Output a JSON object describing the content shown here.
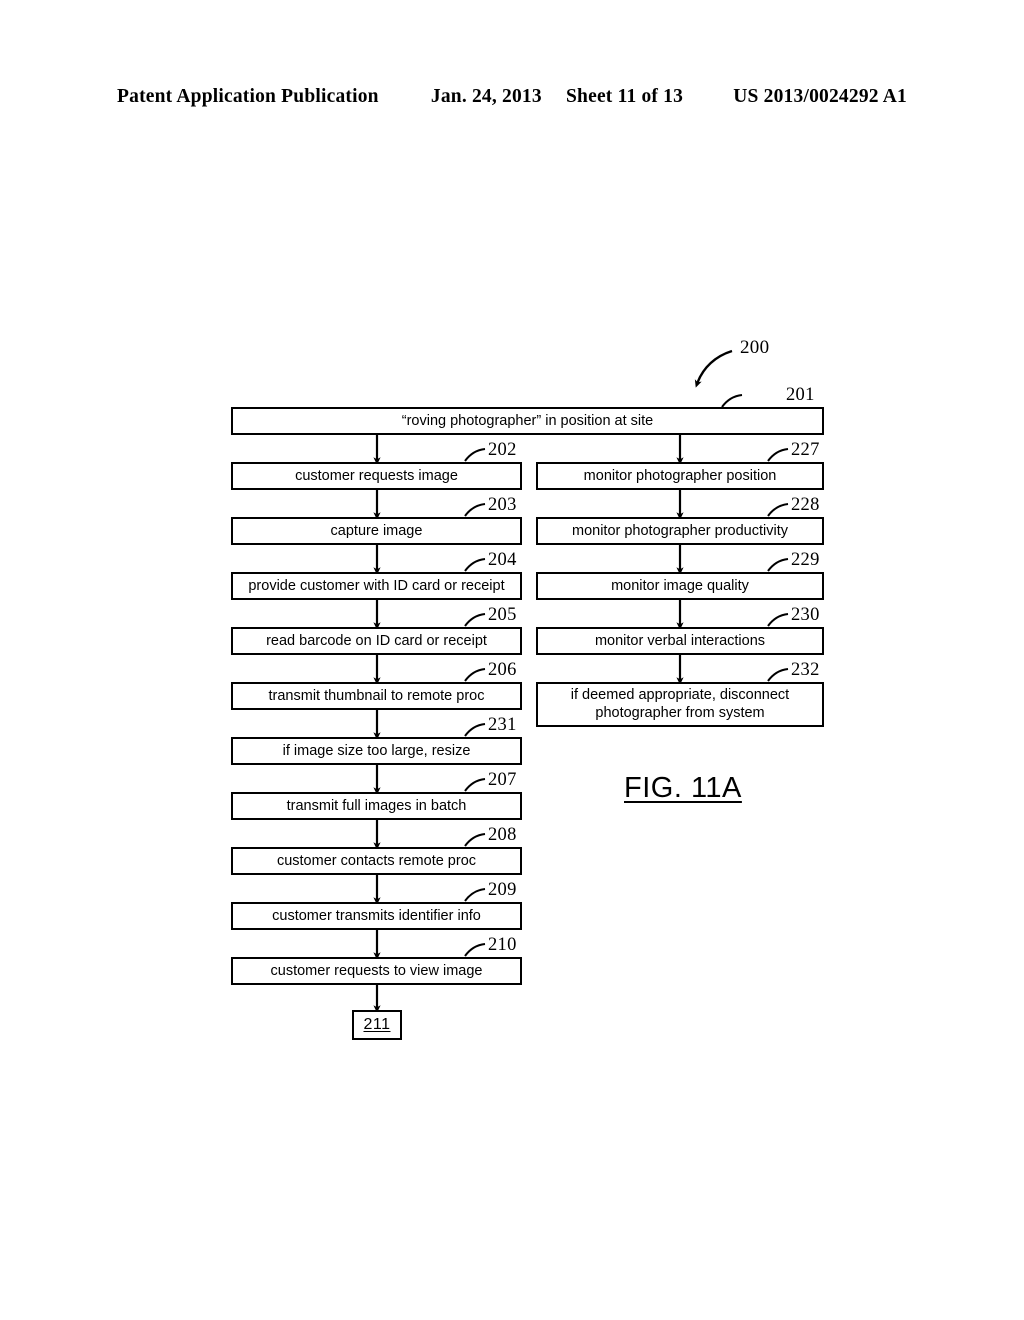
{
  "header": {
    "publication": "Patent Application Publication",
    "date": "Jan. 24, 2013",
    "sheet": "Sheet 11 of 13",
    "pub_number": "US 2013/0024292 A1"
  },
  "figure": {
    "caption_text": "FIG. 11A",
    "system_ref": "200",
    "terminal_ref": "211",
    "boxes": [
      {
        "ref": "201",
        "label": "“roving photographer” in position at site"
      },
      {
        "ref": "202",
        "label": "customer requests image"
      },
      {
        "ref": "203",
        "label": "capture image"
      },
      {
        "ref": "204",
        "label": "provide customer with ID card or receipt"
      },
      {
        "ref": "205",
        "label": "read barcode on ID card or receipt"
      },
      {
        "ref": "206",
        "label": "transmit thumbnail to remote proc"
      },
      {
        "ref": "231",
        "label": "if image size too large, resize"
      },
      {
        "ref": "207",
        "label": "transmit full images in batch"
      },
      {
        "ref": "208",
        "label": "customer contacts remote proc"
      },
      {
        "ref": "209",
        "label": "customer transmits identifier info"
      },
      {
        "ref": "210",
        "label": "customer requests to view image"
      },
      {
        "ref": "227",
        "label": "monitor photographer position"
      },
      {
        "ref": "228",
        "label": "monitor photographer productivity"
      },
      {
        "ref": "229",
        "label": "monitor image quality"
      },
      {
        "ref": "230",
        "label": "monitor verbal interactions"
      },
      {
        "ref": "232",
        "label_line1": "if deemed appropriate, disconnect",
        "label_line2": "photographer from system"
      }
    ]
  }
}
